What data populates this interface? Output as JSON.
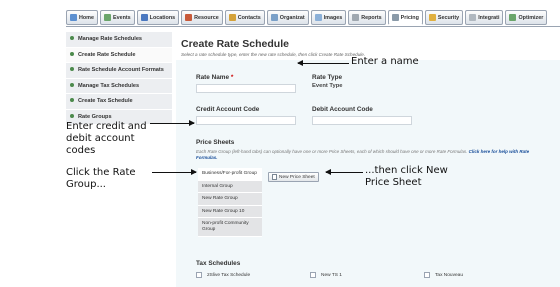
{
  "nav_tabs": [
    {
      "label": "Home",
      "icon": "home-icon",
      "color": "#5b8fd0"
    },
    {
      "label": "Events",
      "icon": "events-icon",
      "color": "#6aa56a"
    },
    {
      "label": "Locations",
      "icon": "locations-icon",
      "color": "#4a78c0"
    },
    {
      "label": "Resource",
      "icon": "resource-icon",
      "color": "#c85a3a"
    },
    {
      "label": "Contacts",
      "icon": "contacts-icon",
      "color": "#d4a23a"
    },
    {
      "label": "Organizat",
      "icon": "organization-icon",
      "color": "#7aa0c8"
    },
    {
      "label": "Images",
      "icon": "images-icon",
      "color": "#8bb0d8"
    },
    {
      "label": "Reports",
      "icon": "reports-icon",
      "color": "#a0a8b0"
    },
    {
      "label": "Pricing",
      "icon": "pricing-icon",
      "color": "#8a9aa8",
      "active": true
    },
    {
      "label": "Security",
      "icon": "security-icon",
      "color": "#e0b040"
    },
    {
      "label": "Integrati",
      "icon": "integration-icon",
      "color": "#b0b8c0"
    },
    {
      "label": "Optimizer",
      "icon": "optimizer-icon",
      "color": "#6aa56a"
    }
  ],
  "sidebar": {
    "items": [
      {
        "label": "Manage Rate Schedules"
      },
      {
        "label": "Create Rate Schedule",
        "active": true
      },
      {
        "label": "Rate Schedule Account Formats"
      },
      {
        "label": "Manage Tax Schedules"
      },
      {
        "label": "Create Tax Schedule"
      },
      {
        "label": "Rate Groups"
      }
    ]
  },
  "main": {
    "title": "Create Rate Schedule",
    "subtitle": "Select a rate schedule type, enter the new rate schedule, then click Create Rate Schedule.",
    "rate_name_label": "Rate Name",
    "rate_name_required": "*",
    "rate_type_label": "Rate Type",
    "rate_type_value": "Event Type",
    "credit_label": "Credit Account Code",
    "debit_label": "Debit Account Code",
    "price_sheets_title": "Price Sheets",
    "price_sheets_desc": "Each Rate Group (left-hand tabs) can optionally have one or more Price Sheets, each of which should have one or more Rate Formulas.",
    "price_sheets_link": "Click here for help with Rate Formulas.",
    "rate_groups": [
      {
        "label": "Business/For-profit Group",
        "selected": true
      },
      {
        "label": "Internal Group"
      },
      {
        "label": "New Rate Group"
      },
      {
        "label": "New Rate Group 10"
      },
      {
        "label": "Non-profit Community Group"
      }
    ],
    "new_price_sheet_label": "New Price Sheet",
    "tax_title": "Tax Schedules",
    "tax_items": [
      {
        "label": "2Slive Tax Schedule"
      },
      {
        "label": "New TS 1"
      },
      {
        "label": "Tax Nouveau"
      }
    ]
  },
  "annotations": {
    "enter_name": "Enter a name",
    "enter_codes": "Enter credit and debit account codes",
    "click_group": "Click the Rate Group...",
    "click_new_sheet": "...then click New Price Sheet"
  }
}
